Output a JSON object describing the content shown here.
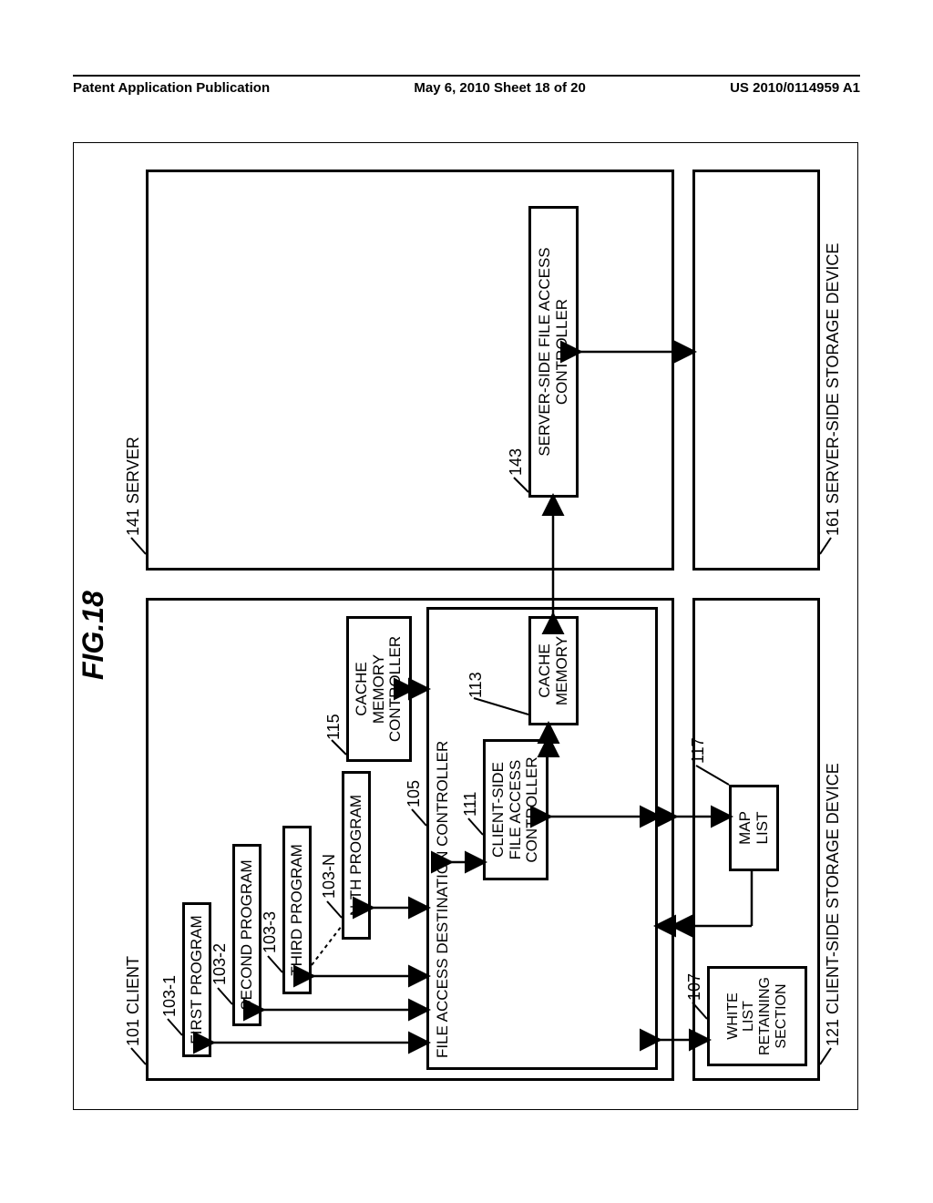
{
  "header": {
    "left": "Patent Application Publication",
    "center": "May 6, 2010  Sheet 18 of 20",
    "right": "US 2010/0114959 A1"
  },
  "fig_title": "FIG.18",
  "refs": {
    "client": "101 CLIENT",
    "p1": "103-1",
    "p2": "103-2",
    "p3": "103-3",
    "pn": "103-N",
    "fadc": "105",
    "wlrs": "107",
    "csfac": "111",
    "cmem": "113",
    "cmc": "115",
    "maplist": "117",
    "client_storage": "121 CLIENT-SIDE STORAGE DEVICE",
    "server": "141 SERVER",
    "ssfac": "143",
    "server_storage": "161 SERVER-SIDE STORAGE DEVICE"
  },
  "labels": {
    "first_program": "FIRST PROGRAM",
    "second_program": "SECOND PROGRAM",
    "third_program": "THIRD PROGRAM",
    "nth_program": "N-TH PROGRAM",
    "fadc": "FILE ACCESS DESTINATION CONTROLLER",
    "wlrs": "WHITE\nLIST\nRETAINING\nSECTION",
    "csfac": "CLIENT-SIDE\nFILE ACCESS\nCONTROLLER",
    "cmem": "CACHE\nMEMORY",
    "cmc": "CACHE\nMEMORY\nCONTROLLER",
    "maplist": "MAP\nLIST",
    "ssfac": "SERVER-SIDE FILE ACCESS\nCONTROLLER"
  }
}
